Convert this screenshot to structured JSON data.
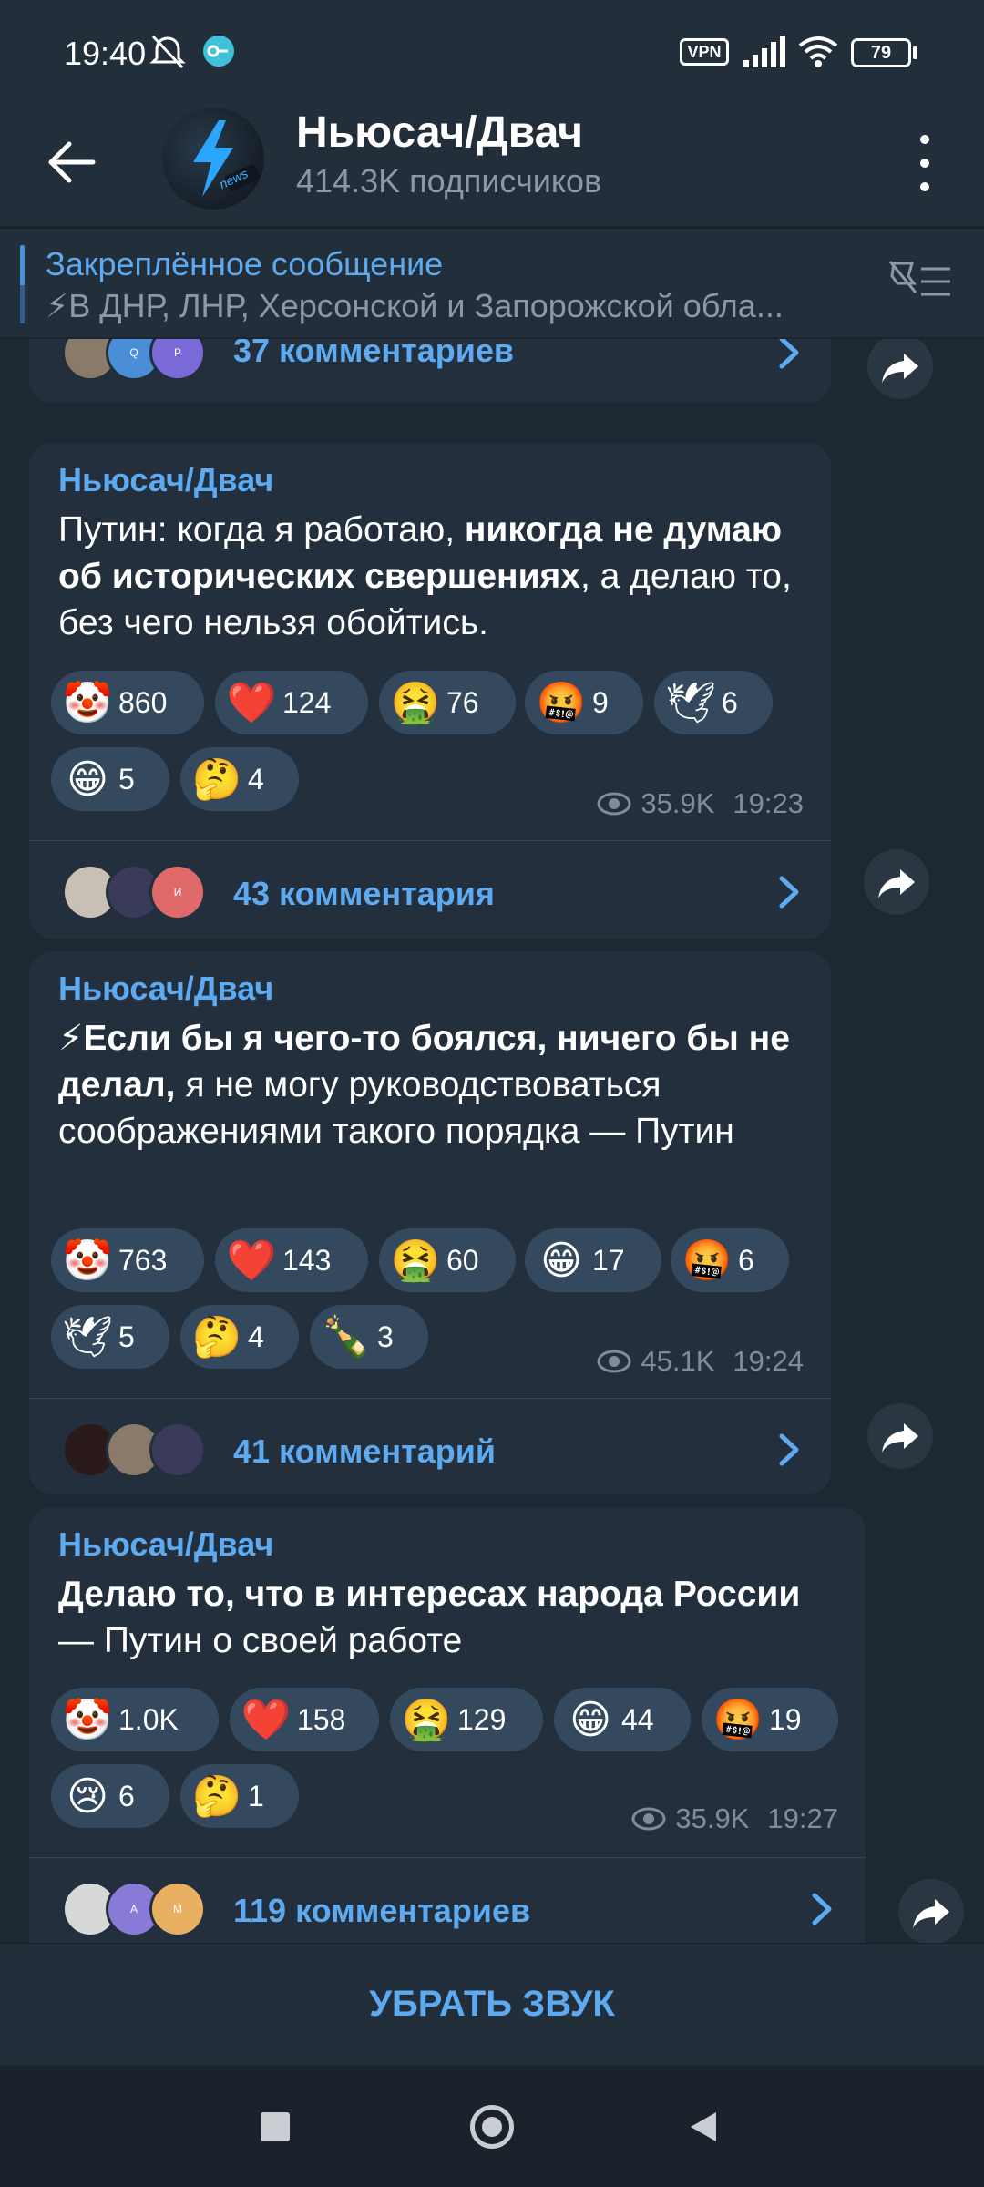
{
  "status": {
    "time": "19:40",
    "battery": "79",
    "vpn_label": "VPN"
  },
  "channel": {
    "title": "Ньюсач/Двач",
    "subscribers": "414.3K подписчиков",
    "avatar_text": "news"
  },
  "pinned": {
    "title": "Закреплённое сообщение",
    "text": "⚡В ДНР, ЛНР, Херсонской и Запорожской обла..."
  },
  "top_comments": {
    "label": "37 комментариев",
    "avatars": [
      "",
      "Q",
      "P"
    ]
  },
  "posts": [
    {
      "author": "Ньюсач/Двач",
      "text_parts": [
        "Путин: когда я работаю, ",
        "никогда не думаю об исторических свершениях",
        ", а делаю то, без чего нельзя обойтись."
      ],
      "reactions": [
        {
          "emoji": "🤡",
          "count": "860"
        },
        {
          "emoji": "❤️",
          "count": "124"
        },
        {
          "emoji": "🤮",
          "count": "76"
        },
        {
          "emoji": "🤬",
          "count": "9"
        },
        {
          "emoji": "🕊",
          "count": "6"
        },
        {
          "emoji": "😁",
          "count": "5"
        },
        {
          "emoji": "🤔",
          "count": "4"
        }
      ],
      "views": "35.9K",
      "time": "19:23",
      "comments": "43 комментария",
      "comment_avatars": [
        "",
        "",
        "И"
      ]
    },
    {
      "author": "Ньюсач/Двач",
      "text_parts": [
        "⚡",
        "Если бы я чего-то боялся, ничего бы не делал,",
        " я не могу руководствоваться соображениями такого порядка — Путин"
      ],
      "reactions": [
        {
          "emoji": "🤡",
          "count": "763"
        },
        {
          "emoji": "❤️",
          "count": "143"
        },
        {
          "emoji": "🤮",
          "count": "60"
        },
        {
          "emoji": "😁",
          "count": "17"
        },
        {
          "emoji": "🤬",
          "count": "6"
        },
        {
          "emoji": "🕊",
          "count": "5"
        },
        {
          "emoji": "🤔",
          "count": "4"
        },
        {
          "emoji": "🍾",
          "count": "3"
        }
      ],
      "views": "45.1K",
      "time": "19:24",
      "comments": "41 комментарий",
      "comment_avatars": [
        "",
        "",
        ""
      ]
    },
    {
      "author": "Ньюсач/Двач",
      "text_parts": [
        "",
        "Делаю то, что в интересах народа России",
        " — Путин о своей работе"
      ],
      "reactions": [
        {
          "emoji": "🤡",
          "count": "1.0K"
        },
        {
          "emoji": "❤️",
          "count": "158"
        },
        {
          "emoji": "🤮",
          "count": "129"
        },
        {
          "emoji": "😁",
          "count": "44"
        },
        {
          "emoji": "🤬",
          "count": "19"
        },
        {
          "emoji": "😢",
          "count": "6"
        },
        {
          "emoji": "🤔",
          "count": "1"
        }
      ],
      "views": "35.9K",
      "time": "19:27",
      "comments": "119 комментариев",
      "comment_avatars": [
        "",
        "А",
        "М"
      ]
    }
  ],
  "mute_button": "УБРАТЬ ЗВУК",
  "colors": {
    "accent": "#5eaaf0",
    "bubble": "#232f3c",
    "background": "#1d2833"
  }
}
